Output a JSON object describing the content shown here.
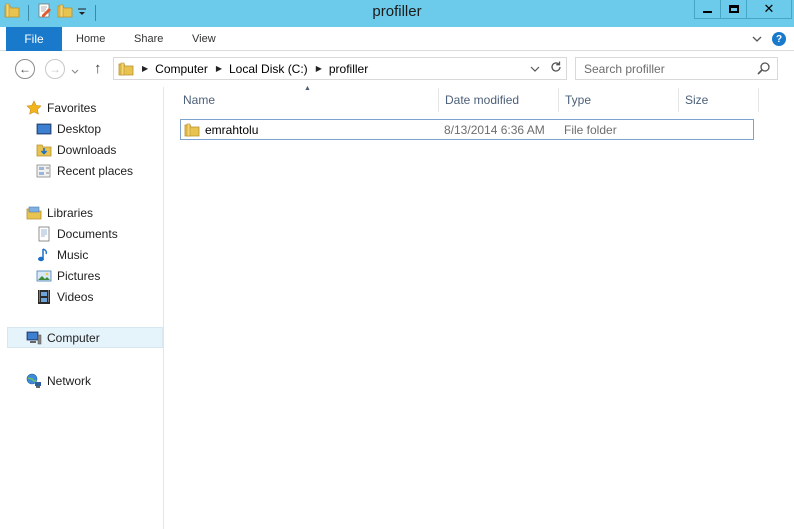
{
  "window": {
    "title": "profiller",
    "controls": {
      "minimize": "minimize",
      "maximize": "maximize",
      "close": "✕"
    }
  },
  "ribbon": {
    "tabs": [
      "File",
      "Home",
      "Share",
      "View"
    ]
  },
  "navigation": {
    "back": "←",
    "forward": "→",
    "up": "↑",
    "breadcrumb": [
      "Computer",
      "Local Disk (C:)",
      "profiller"
    ],
    "search_placeholder": "Search profiller"
  },
  "sidebar": {
    "favorites": {
      "label": "Favorites",
      "items": [
        {
          "label": "Desktop",
          "icon": "desktop-icon"
        },
        {
          "label": "Downloads",
          "icon": "downloads-icon"
        },
        {
          "label": "Recent places",
          "icon": "recent-places-icon"
        }
      ]
    },
    "libraries": {
      "label": "Libraries",
      "items": [
        {
          "label": "Documents",
          "icon": "documents-icon"
        },
        {
          "label": "Music",
          "icon": "music-icon"
        },
        {
          "label": "Pictures",
          "icon": "pictures-icon"
        },
        {
          "label": "Videos",
          "icon": "videos-icon"
        }
      ]
    },
    "computer": {
      "label": "Computer",
      "icon": "computer-icon",
      "selected": true
    },
    "network": {
      "label": "Network",
      "icon": "network-icon"
    }
  },
  "filelist": {
    "columns": [
      "Name",
      "Date modified",
      "Type",
      "Size"
    ],
    "sorted_by": "Name",
    "rows": [
      {
        "name": "emrahtolu",
        "date_modified": "8/13/2014 6:36 AM",
        "type": "File folder",
        "size": ""
      }
    ]
  },
  "colors": {
    "titlebar": "#6ccbea",
    "file_tab": "#1979ca",
    "selection": "#e5f3fb",
    "header_text": "#4c607a"
  }
}
